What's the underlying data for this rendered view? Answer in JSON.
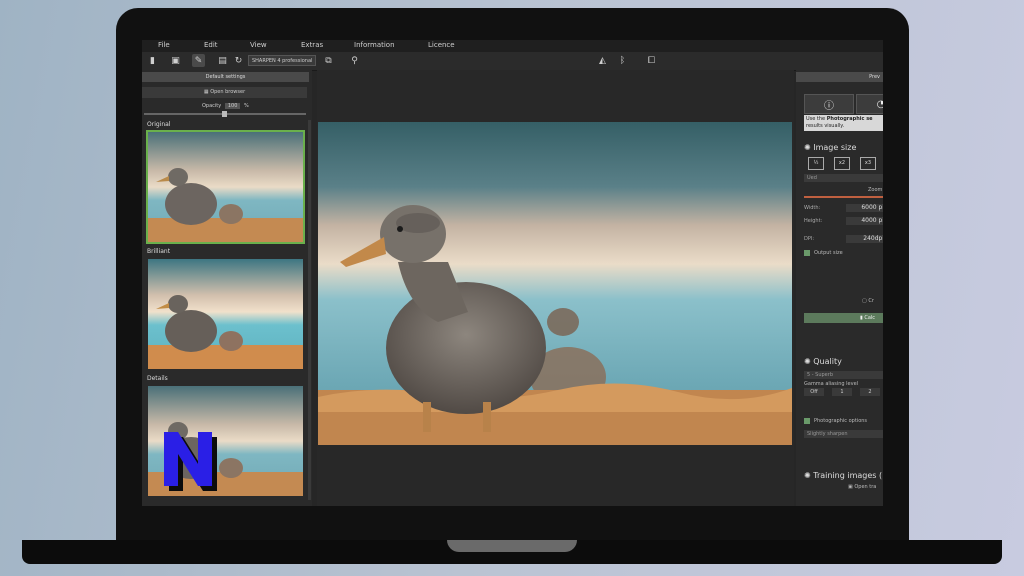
{
  "menu": [
    "File",
    "Edit",
    "View",
    "Extras",
    "Information",
    "Licence"
  ],
  "toolbar": {
    "profile": "SHARPEN 4 professional"
  },
  "left_panel": {
    "header": "Default settings",
    "browser_button": "Open browser",
    "opacity_label": "Opacity",
    "opacity_value": "100",
    "opacity_unit": "%",
    "presets": [
      "Original",
      "Brilliant",
      "Details"
    ]
  },
  "right_panel": {
    "header": "Prev",
    "hint_prefix": "Use the ",
    "hint_bold": "Photographic se",
    "hint_rest": "results visually.",
    "image_size_title": "Image size",
    "scale_buttons": [
      "½",
      "x2",
      "x3"
    ],
    "unit_label": "Ued",
    "zoom_label": "Zoom",
    "width_label": "Width:",
    "width_value": "6000 pi",
    "height_label": "Height:",
    "height_value": "4000 pi",
    "dpi_label": "DPI:",
    "dpi_value": "240dpi",
    "output_size_label": "Output size",
    "button_a": "Cr",
    "button_b": "Calc",
    "quality_title": "Quality",
    "quality_value": "5 - Superb",
    "gamma_label": "Gamma aliasing level",
    "gamma_options": [
      "Off",
      "1",
      "2"
    ],
    "photo_options_label": "Photographic options",
    "photo_options_value": "Slightly sharpen",
    "training_title": "Training images (",
    "open_training": "Open tra"
  },
  "logo_letter": "N",
  "colors": {
    "accent_green": "#6ab04c",
    "logo_blue": "#2a1fe6"
  }
}
